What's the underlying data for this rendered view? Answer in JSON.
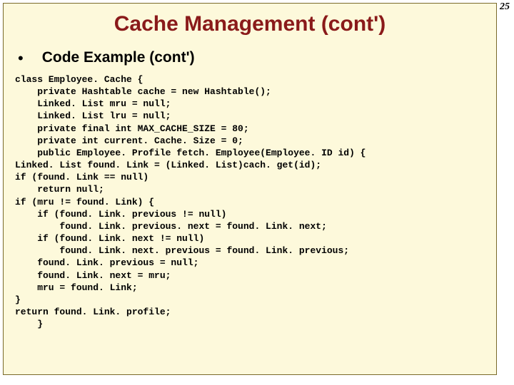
{
  "page_number": "25",
  "title": "Cache Management (cont')",
  "subheading": "Code Example (cont')",
  "code": "class Employee. Cache {\n    private Hashtable cache = new Hashtable();\n    Linked. List mru = null;\n    Linked. List lru = null;\n    private final int MAX_CACHE_SIZE = 80;\n    private int current. Cache. Size = 0;\n    public Employee. Profile fetch. Employee(Employee. ID id) {\nLinked. List found. Link = (Linked. List)cach. get(id);\nif (found. Link == null)\n    return null;\nif (mru != found. Link) {\n    if (found. Link. previous != null)\n        found. Link. previous. next = found. Link. next;\n    if (found. Link. next != null)\n        found. Link. next. previous = found. Link. previous;\n    found. Link. previous = null;\n    found. Link. next = mru;\n    mru = found. Link;\n}\nreturn found. Link. profile;\n    }"
}
